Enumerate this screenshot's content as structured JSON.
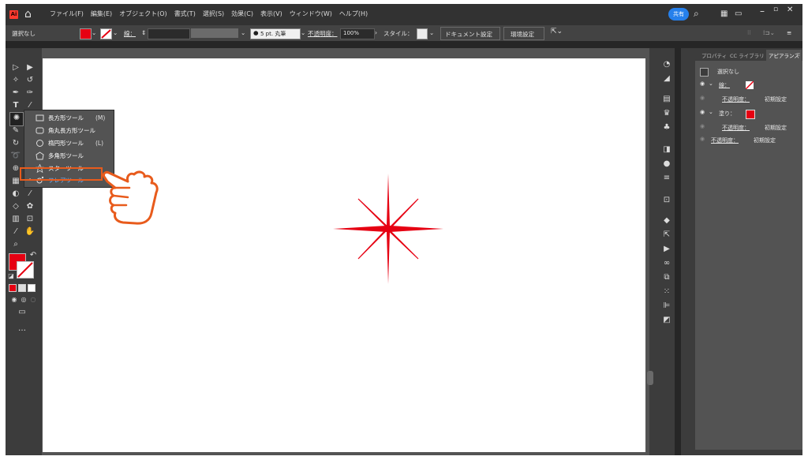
{
  "menubar": {
    "logo": "Ai",
    "items": [
      "ファイル(F)",
      "編集(E)",
      "オブジェクト(O)",
      "書式(T)",
      "選択(S)",
      "効果(C)",
      "表示(V)",
      "ウィンドウ(W)",
      "ヘルプ(H)"
    ],
    "share_label": "共有",
    "window_controls": [
      "minimize-icon",
      "maximize-icon",
      "close-icon"
    ]
  },
  "controlbar": {
    "selection": "選択なし",
    "stroke_label": "線：",
    "brush_label": "5 pt. 丸筆",
    "opacity_label": "不透明度：",
    "opacity_value": "100%",
    "style_label": "スタイル：",
    "doc_setup": "ドキュメント設定",
    "preferences": "環境設定"
  },
  "flyout": {
    "items": [
      {
        "label": "長方形ツール",
        "key": "(M)",
        "icon": "rectangle-tool-icon"
      },
      {
        "label": "角丸長方形ツール",
        "key": "",
        "icon": "rounded-rectangle-tool-icon"
      },
      {
        "label": "楕円形ツール",
        "key": "(L)",
        "icon": "ellipse-tool-icon"
      },
      {
        "label": "多角形ツール",
        "key": "",
        "icon": "polygon-tool-icon"
      },
      {
        "label": "スターツール",
        "key": "",
        "icon": "star-tool-icon"
      },
      {
        "label": "フレアツール",
        "key": "",
        "icon": "flare-tool-icon",
        "selected": true
      }
    ]
  },
  "panel": {
    "tabs": [
      "プロパティ",
      "CC ライブラリ",
      "アピアランス"
    ],
    "active_tab": "アピアランス",
    "title": "選択なし",
    "stroke_label": "線：",
    "opacity_label": "不透明度：",
    "opacity_value": "初期設定",
    "fill_label": "塗り：",
    "fill_opacity_label": "不透明度：",
    "fill_opacity_value": "初期設定",
    "bottom_opacity_label": "不透明度：",
    "bottom_opacity_value": "初期設定"
  },
  "colors": {
    "accent_red": "#e60012",
    "highlight": "#e85b1c",
    "share_blue": "#2680eb"
  }
}
